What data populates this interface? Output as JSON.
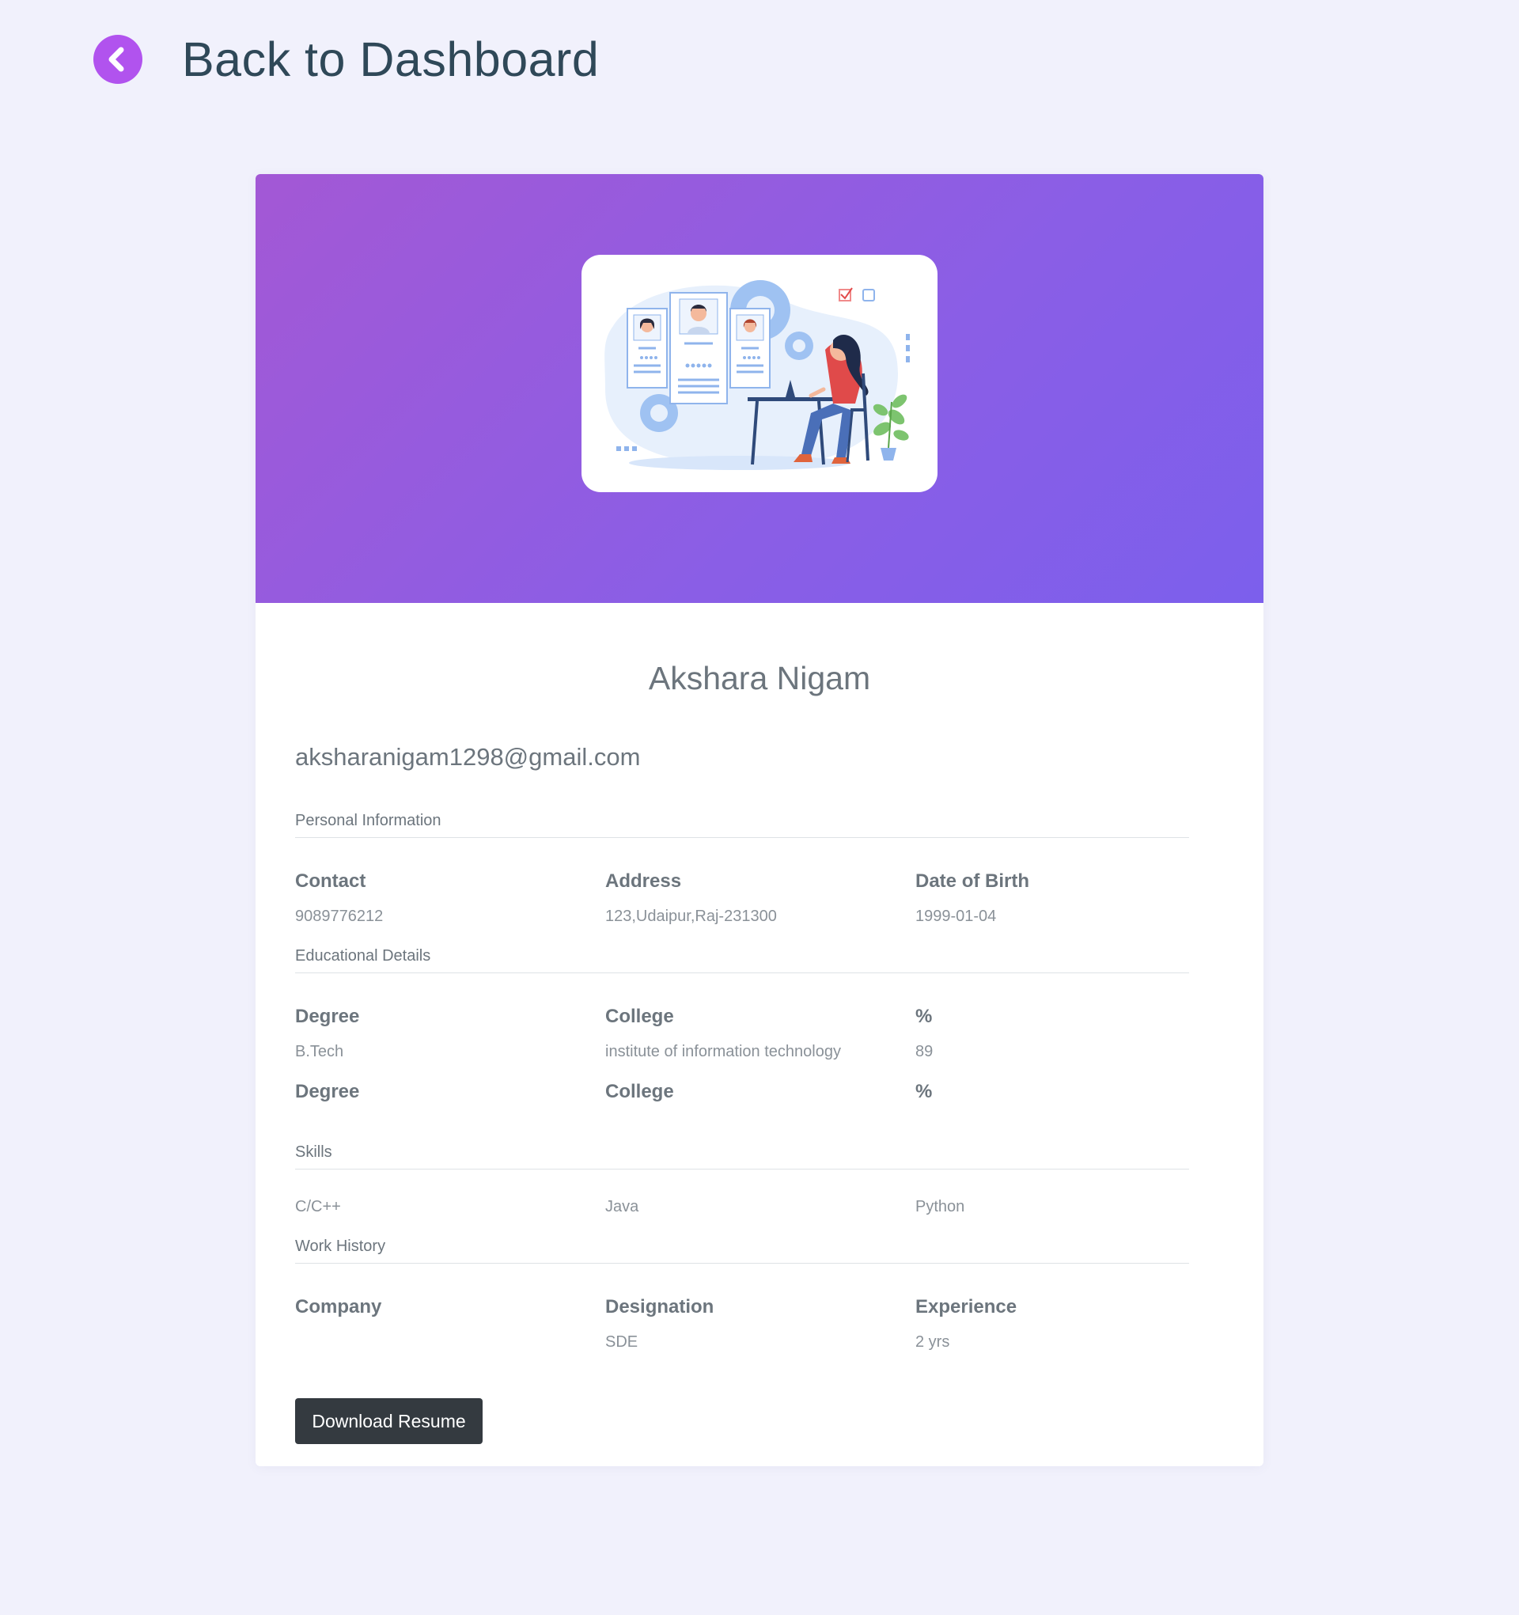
{
  "header": {
    "back_label": "Back to Dashboard",
    "back_icon": "chevron-left-icon",
    "accent_color": "#b153ee"
  },
  "profile": {
    "name": "Akshara Nigam",
    "email": "aksharanigam1298@gmail.com"
  },
  "personal": {
    "title": "Personal Information",
    "contact_label": "Contact",
    "contact_value": "9089776212",
    "address_label": "Address",
    "address_value": "123,Udaipur,Raj-231300",
    "dob_label": "Date of Birth",
    "dob_value": "1999-01-04"
  },
  "education": {
    "title": "Educational Details",
    "entries": [
      {
        "degree_label": "Degree",
        "degree": "B.Tech",
        "college_label": "College",
        "college": "institute of information technology",
        "percent_label": "%",
        "percent": "89"
      },
      {
        "degree_label": "Degree",
        "degree": "",
        "college_label": "College",
        "college": "",
        "percent_label": "%",
        "percent": ""
      }
    ]
  },
  "skills": {
    "title": "Skills",
    "items": [
      "C/C++",
      "Java",
      "Python"
    ]
  },
  "work": {
    "title": "Work History",
    "company_label": "Company",
    "company_value": "",
    "designation_label": "Designation",
    "designation_value": "SDE",
    "experience_label": "Experience",
    "experience_value": "2 yrs"
  },
  "actions": {
    "download_label": "Download Resume"
  },
  "theme": {
    "banner_gradient_start": "#a358d5",
    "banner_gradient_end": "#7c5fec",
    "button_color": "#343a40"
  }
}
